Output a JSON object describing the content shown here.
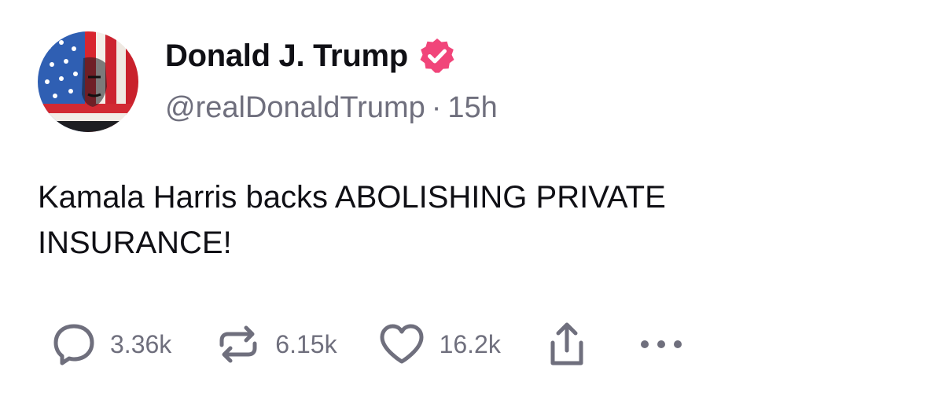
{
  "author": {
    "display_name": "Donald J. Trump",
    "handle": "@realDonaldTrump",
    "separator": "·",
    "time_ago": "15h",
    "verified": true,
    "verified_color": "#f1457a"
  },
  "post": {
    "text": "Kamala Harris backs ABOLISHING PRIVATE INSURANCE!"
  },
  "actions": {
    "replies": "3.36k",
    "reposts": "6.15k",
    "likes": "16.2k",
    "icons": [
      "reply-icon",
      "repost-icon",
      "heart-icon",
      "share-icon",
      "more-icon"
    ],
    "icon_color": "#6f6f7d"
  }
}
